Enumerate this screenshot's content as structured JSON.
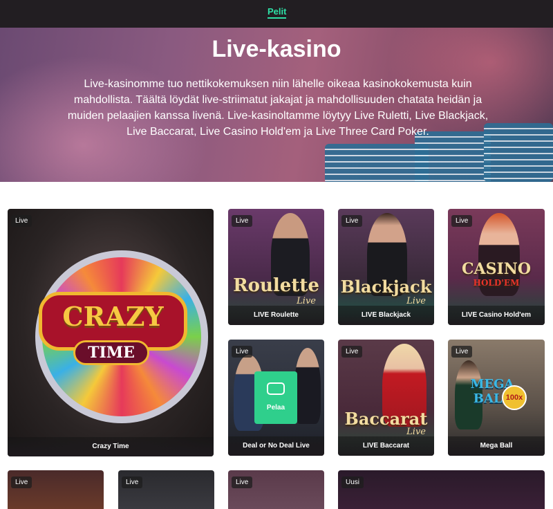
{
  "nav": {
    "games_link": "Pelit"
  },
  "hero": {
    "title": "Live-kasino",
    "description": "Live-kasinomme tuo nettikokemuksen niin lähelle oikeaa kasinokokemusta kuin mahdollista. Täältä löydät live-striimatut jakajat ja mahdollisuuden chatata heidän ja muiden pelaajien kanssa livenä. Live-kasinoltamme löytyy Live Ruletti, Live Blackjack, Live Baccarat, Live Casino Hold'em ja Live Three Card Poker."
  },
  "tiles": {
    "crazy_time": {
      "badge": "Live",
      "logo_top": "CRAZY",
      "logo_bottom": "TIME",
      "caption": "Crazy Time"
    },
    "roulette": {
      "badge": "Live",
      "title": "Roulette",
      "sub": "Live",
      "caption": "LIVE Roulette"
    },
    "blackjack": {
      "badge": "Live",
      "title": "Blackjack",
      "sub": "Live",
      "caption": "LIVE Blackjack"
    },
    "holdem": {
      "badge": "Live",
      "title": "CASINO",
      "sub": "HOLD'EM",
      "caption": "LIVE Casino Hold'em"
    },
    "deal": {
      "badge": "Live",
      "play": "Pelaa",
      "caption": "Deal or No Deal Live"
    },
    "baccarat": {
      "badge": "Live",
      "title": "Baccarat",
      "sub": "Live",
      "caption": "LIVE Baccarat"
    },
    "mega_ball": {
      "badge": "Live",
      "title": "MEGA BALL",
      "multiplier": "100x",
      "caption": "Mega Ball"
    },
    "row3": [
      {
        "badge": "Live"
      },
      {
        "badge": "Live"
      },
      {
        "badge": "Live"
      },
      {
        "badge": "Uusi"
      }
    ]
  },
  "colors": {
    "accent": "#2ee0a6",
    "play_button": "#2fcf8c",
    "topbar": "#221e22"
  }
}
